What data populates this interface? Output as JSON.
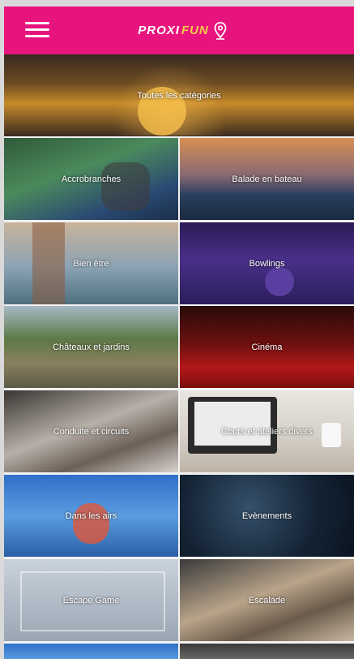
{
  "header": {
    "logo_part1": "PROXI",
    "logo_part2": "FUN",
    "menu_icon": "hamburger-menu-icon",
    "pin_icon": "map-pin-icon",
    "brand_color": "#e8147d"
  },
  "categories": [
    {
      "label": "Toutes les catégories"
    },
    {
      "label": "Accrobranches"
    },
    {
      "label": "Balade en bateau"
    },
    {
      "label": "Bien être"
    },
    {
      "label": "Bowlings"
    },
    {
      "label": "Châteaux et jardins"
    },
    {
      "label": "Cinéma"
    },
    {
      "label": "Conduite et circuits"
    },
    {
      "label": "Cours et ateliers divers"
    },
    {
      "label": "Dans les airs"
    },
    {
      "label": "Evènements"
    },
    {
      "label": "Escape Game"
    },
    {
      "label": "Escalade"
    }
  ]
}
